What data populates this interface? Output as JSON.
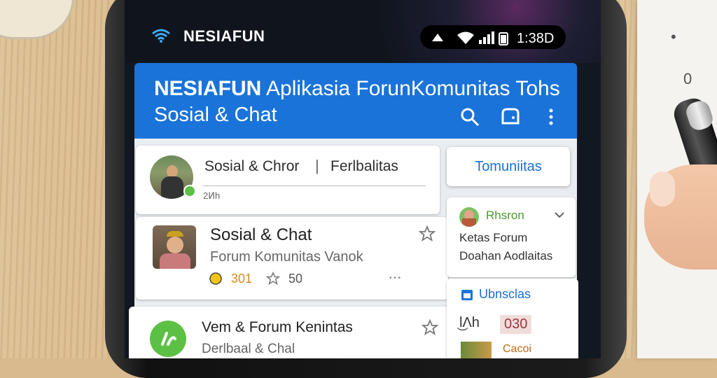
{
  "status_bar": {
    "brand": "NESIAFUN",
    "time": "1:38D"
  },
  "header": {
    "title_brand": "NESIAFUN",
    "title_rest": "Aplikasia ForunKomunitas Tohs",
    "subtitle": "Sosial & Chat",
    "icons": [
      "search-icon",
      "chat-icon",
      "more-vert-icon"
    ]
  },
  "feed": [
    {
      "title": "Sosial & Chror",
      "tag": "Ferlbalitas",
      "time": "2Ͷh"
    },
    {
      "title": "Sosial & Chat",
      "subtitle": "Forum Komunitas Vanok",
      "count": "301",
      "stars": "50",
      "more": "• • •"
    },
    {
      "title": "Vem & Forum Kenintas",
      "subtitle": "Derlbaal & Chal"
    }
  ],
  "sidebar": {
    "button_label": "Tomuniitas",
    "card1": {
      "name": "Rhsron",
      "line1": "Ketas Forum",
      "line2": "Doahan Aodlaitas"
    },
    "card2": {
      "title": "Ubnsclas",
      "badge_left": "l͜Λh",
      "badge_value": "030",
      "footer": "Cacoi"
    }
  },
  "colors": {
    "header_blue": "#1a73d9",
    "accent_green": "#5cc045",
    "accent_orange": "#d68a1a"
  }
}
